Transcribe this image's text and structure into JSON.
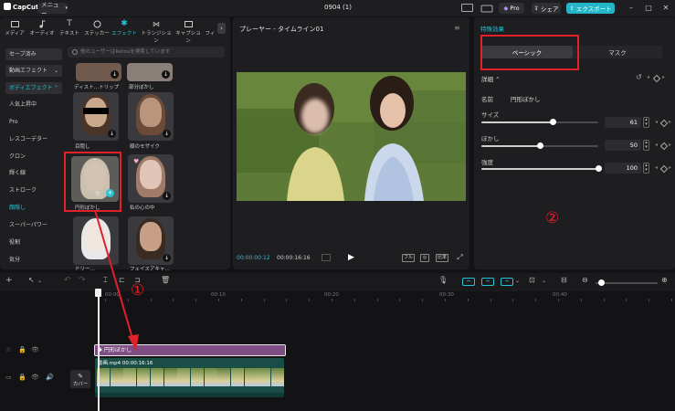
{
  "app": {
    "logo_text": "CapCut",
    "menu_label": "メニュー",
    "window_title": "0904 (1)",
    "pro_label": "Pro",
    "share_label": "シェア",
    "export_label": "エクスポート"
  },
  "media_tabs": [
    {
      "label": "メディア"
    },
    {
      "label": "オーディオ"
    },
    {
      "label": "テキスト"
    },
    {
      "label": "ステッカー"
    },
    {
      "label": "エフェクト"
    },
    {
      "label": "トランジション"
    },
    {
      "label": "キャプション"
    },
    {
      "label": "フィ"
    }
  ],
  "categories": [
    {
      "label": "セーブ済み"
    },
    {
      "label": "動画エフェクト"
    },
    {
      "label": "ボディエフェクト"
    },
    {
      "label": "人気上昇中"
    },
    {
      "label": "Pro"
    },
    {
      "label": "レスコーデター"
    },
    {
      "label": "クロン"
    },
    {
      "label": "輝く線"
    },
    {
      "label": "ストローク"
    },
    {
      "label": "顔隠し"
    },
    {
      "label": "スーパーパワー"
    },
    {
      "label": "役割"
    },
    {
      "label": "気分"
    }
  ],
  "search": {
    "placeholder": "他のユーザーはRetouを検索しています"
  },
  "effects": [
    {
      "label": "ディスト…トリップ"
    },
    {
      "label": "部分ぼかし"
    },
    {
      "label": "目隠し"
    },
    {
      "label": "顔のモザイク"
    },
    {
      "label": "円形ぼかし"
    },
    {
      "label": "私の心の中"
    },
    {
      "label": "ドリー…"
    },
    {
      "label": "フェイスアキャ…"
    }
  ],
  "player": {
    "title": "プレーヤー - タイムライン01",
    "time_current": "00:00:00:12",
    "time_total": "00:00:16:16",
    "ctrl_full": "フル",
    "ctrl_ratio": "比率"
  },
  "effect_panel": {
    "title": "特殊効果",
    "tab_basic": "ベーシック",
    "tab_mask": "マスク",
    "detail_label": "詳細",
    "name_key": "名前",
    "name_value": "円形ぼかし",
    "params": [
      {
        "label": "サイズ",
        "value": "61",
        "fraction": 0.61
      },
      {
        "label": "ぼかし",
        "value": "50",
        "fraction": 0.5
      },
      {
        "label": "強度",
        "value": "100",
        "fraction": 1.0
      }
    ]
  },
  "timeline": {
    "ruler": [
      "00:00",
      "00:10",
      "00:20",
      "00:30",
      "00:40"
    ],
    "fx_clip_label": "円形ぼかし",
    "video_clip_label": "動画.mp4   00:00:16:16",
    "cover_label": "カバー"
  },
  "annotations": {
    "marker_one": "①",
    "marker_two": "②"
  },
  "colors": {
    "accent": "#23c4d8",
    "highlight": "#e2202a",
    "fx_clip": "#7d4d84",
    "video_clip": "#1b4d47"
  }
}
